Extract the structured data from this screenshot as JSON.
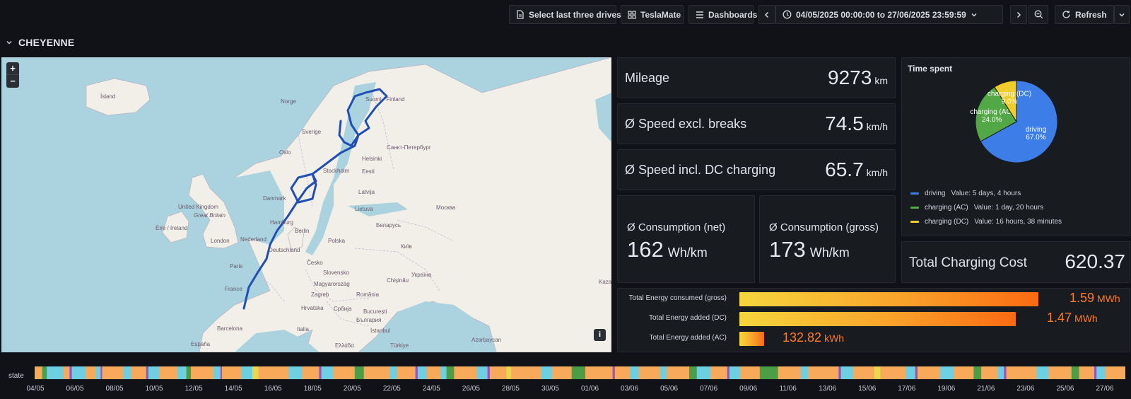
{
  "toolbar": {
    "select_drives_label": "Select last three drives",
    "teslamate_label": "TeslaMate",
    "dashboards_label": "Dashboards",
    "time_range": "04/05/2025 00:00:00 to 27/06/2025 23:59:59",
    "refresh_label": "Refresh"
  },
  "row": {
    "title": "CHEYENNE"
  },
  "map": {
    "labels": [
      {
        "text": "Ísland",
        "name": "map-label-island"
      },
      {
        "text": "Norge",
        "name": "map-label-norge"
      },
      {
        "text": "Sverige",
        "name": "map-label-sverige"
      },
      {
        "text": "Oslo",
        "name": "map-label-oslo"
      },
      {
        "text": "Suomi / Finland",
        "name": "map-label-suomi"
      },
      {
        "text": "Санкт-Петербург",
        "name": "map-label-spb"
      },
      {
        "text": "Helsinki",
        "name": "map-label-helsinki"
      },
      {
        "text": "Stockholm",
        "name": "map-label-stockholm"
      },
      {
        "text": "Eesti",
        "name": "map-label-eesti"
      },
      {
        "text": "Latvija",
        "name": "map-label-latvija"
      },
      {
        "text": "Danmark",
        "name": "map-label-danmark"
      },
      {
        "text": "Lietuva",
        "name": "map-label-lietuva"
      },
      {
        "text": "Москва",
        "name": "map-label-moskva"
      },
      {
        "text": "Беларусь",
        "name": "map-label-belarus"
      },
      {
        "text": "United Kingdom",
        "name": "map-label-uk"
      },
      {
        "text": "Great Britain",
        "name": "map-label-gb"
      },
      {
        "text": "Éire / Ireland",
        "name": "map-label-ireland"
      },
      {
        "text": "Hamburg",
        "name": "map-label-hamburg"
      },
      {
        "text": "Berlin",
        "name": "map-label-berlin"
      },
      {
        "text": "Polska",
        "name": "map-label-polska"
      },
      {
        "text": "Nederland",
        "name": "map-label-nederland"
      },
      {
        "text": "London",
        "name": "map-label-london"
      },
      {
        "text": "Deutschland",
        "name": "map-label-deutschland"
      },
      {
        "text": "Київ",
        "name": "map-label-kyiv"
      },
      {
        "text": "Paris",
        "name": "map-label-paris"
      },
      {
        "text": "Česko",
        "name": "map-label-cesko"
      },
      {
        "text": "Slovensko",
        "name": "map-label-slovensko"
      },
      {
        "text": "Україна",
        "name": "map-label-ukraina"
      },
      {
        "text": "France",
        "name": "map-label-france"
      },
      {
        "text": "Magyarország",
        "name": "map-label-magyarorszag"
      },
      {
        "text": "Chișinău",
        "name": "map-label-chisinau"
      },
      {
        "text": "Zagreb",
        "name": "map-label-zagreb"
      },
      {
        "text": "România",
        "name": "map-label-romania"
      },
      {
        "text": "Hrvatska",
        "name": "map-label-hrvatska"
      },
      {
        "text": "Србија",
        "name": "map-label-srbija"
      },
      {
        "text": "București",
        "name": "map-label-bucuresti"
      },
      {
        "text": "България",
        "name": "map-label-bulgaria"
      },
      {
        "text": "Barcelona",
        "name": "map-label-barcelona"
      },
      {
        "text": "Italia",
        "name": "map-label-italia"
      },
      {
        "text": "İstanbul",
        "name": "map-label-istanbul"
      },
      {
        "text": "Azərbaycan",
        "name": "map-label-azerbaycan"
      },
      {
        "text": "España",
        "name": "map-label-espana"
      },
      {
        "text": "Ελλάδα",
        "name": "map-label-ellada"
      },
      {
        "text": "Türkiye",
        "name": "map-label-turkiye"
      },
      {
        "text": "Kaza",
        "name": "map-label-kaza"
      }
    ],
    "zoom_in": "+",
    "zoom_out": "−",
    "info": "i"
  },
  "stats": {
    "mileage": {
      "label": "Mileage",
      "value": "9273",
      "unit": "km"
    },
    "speed_excl": {
      "label": "Ø Speed excl. breaks",
      "value": "74.5",
      "unit": "km/h"
    },
    "speed_incl": {
      "label": "Ø Speed incl. DC charging",
      "value": "65.7",
      "unit": "km/h"
    },
    "cons_net": {
      "label": "Ø Consumption (net)",
      "value": "162",
      "unit": "Wh/km"
    },
    "cons_gross": {
      "label": "Ø Consumption (gross)",
      "value": "173",
      "unit": "Wh/km"
    },
    "charging_cost": {
      "label": "Total Charging Cost",
      "value": "620.37"
    }
  },
  "time_spent": {
    "title": "Time spent",
    "slices": [
      {
        "name": "driving",
        "percent": 67.0,
        "percent_label": "67.0%",
        "color": "#3d7de8",
        "legend_value": "Value: 5 days, 4 hours"
      },
      {
        "name": "charging (AC)",
        "percent": 24.0,
        "percent_label": "24.0%",
        "color": "#52a845",
        "legend_value": "Value: 1 day, 20 hours"
      },
      {
        "name": "charging (DC)",
        "percent": 9.0,
        "percent_label": "9.0%",
        "color": "#f0cd2a",
        "legend_value": "Value: 16 hours, 38 minutes"
      }
    ]
  },
  "energy": {
    "max_mwh": 1.59,
    "rows": [
      {
        "label": "Total Energy consumed (gross)",
        "value": "1.59",
        "unit": "MWh",
        "mwh": 1.59
      },
      {
        "label": "Total Energy added (DC)",
        "value": "1.47",
        "unit": "MWh",
        "mwh": 1.47
      },
      {
        "label": "Total Energy added (AC)",
        "value": "132.82",
        "unit": "kWh",
        "mwh": 0.13282
      }
    ]
  },
  "state_timeline": {
    "label": "state",
    "colors": {
      "driving": "#f8a95a",
      "charging": "#6dcfe2",
      "ac": "#4a9e46",
      "dc": "#9b51c2",
      "sleep": "#e9d84a"
    },
    "ticks": [
      "04/05",
      "06/05",
      "08/05",
      "10/05",
      "12/05",
      "14/05",
      "16/05",
      "18/05",
      "20/05",
      "22/05",
      "24/05",
      "26/05",
      "28/05",
      "30/05",
      "01/06",
      "03/06",
      "05/06",
      "07/06",
      "09/06",
      "11/06",
      "13/06",
      "15/06",
      "17/06",
      "19/06",
      "21/06",
      "23/06",
      "25/06",
      "27/06"
    ]
  }
}
